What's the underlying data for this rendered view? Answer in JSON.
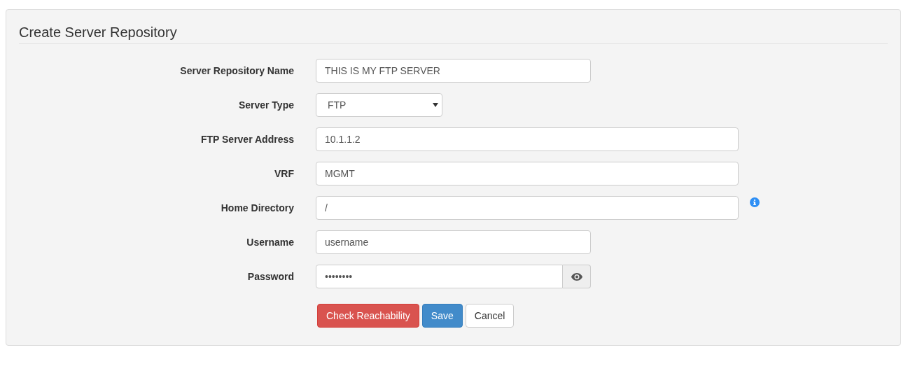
{
  "panel": {
    "title": "Create Server Repository"
  },
  "fields": [
    {
      "kind": "text",
      "label": "Server Repository Name",
      "value": "THIS IS MY FTP SERVER",
      "wide": false,
      "info": false
    },
    {
      "kind": "select",
      "label": "Server Type",
      "value": "FTP",
      "wide": false,
      "info": false
    },
    {
      "kind": "text",
      "label": "FTP Server Address",
      "value": "10.1.1.2",
      "wide": true,
      "info": false
    },
    {
      "kind": "text",
      "label": "VRF",
      "value": "MGMT",
      "wide": true,
      "info": false
    },
    {
      "kind": "text",
      "label": "Home Directory",
      "value": "/",
      "wide": true,
      "info": true
    },
    {
      "kind": "text",
      "label": "Username",
      "value": "username",
      "wide": false,
      "info": false
    },
    {
      "kind": "password",
      "label": "Password",
      "value": "••••••••",
      "wide": false,
      "info": false
    }
  ],
  "buttons": [
    {
      "kind": "danger",
      "label": "Check Reachability"
    },
    {
      "kind": "primary",
      "label": "Save"
    },
    {
      "kind": "default",
      "label": "Cancel"
    }
  ]
}
